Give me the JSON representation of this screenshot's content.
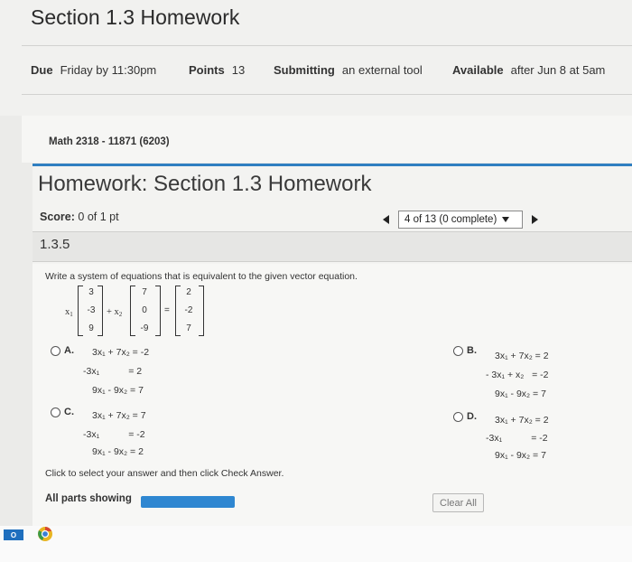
{
  "assignment": {
    "title": "Section 1.3 Homework",
    "details": [
      {
        "label": "Due",
        "value": "Friday by 11:30pm"
      },
      {
        "label": "Points",
        "value": "13"
      },
      {
        "label": "Submitting",
        "value": "an external tool"
      },
      {
        "label": "Available",
        "value": "after Jun 8 at 5am"
      }
    ]
  },
  "course": {
    "name": "Math 2318 - 11871 (6203)"
  },
  "homework": {
    "title": "Homework: Section 1.3 Homework",
    "score_label": "Score:",
    "score_value": "0 of 1 pt",
    "progress": "4 of 13 (0 complete)",
    "question_number": "1.3.5"
  },
  "question": {
    "prompt": "Write a system of equations that is equivalent to the given vector equation.",
    "vector_equation": {
      "x1_label": "x",
      "x1_sub": "1",
      "x2_label": "+ x",
      "x2_sub": "2",
      "v1": [
        "3",
        "-3",
        "9"
      ],
      "v2": [
        "7",
        "0",
        "-9"
      ],
      "equals": "=",
      "rhs": [
        "2",
        "-2",
        "7"
      ]
    },
    "options": [
      {
        "letter": "A.",
        "eqs": [
          "3x₁ + 7x₂ = -2",
          "-3x₁           = 2",
          "9x₁ - 9x₂ = 7"
        ]
      },
      {
        "letter": "B.",
        "eqs": [
          "3x₁ + 7x₂ = 2",
          "- 3x₁ + x₂   = -2",
          "9x₁ - 9x₂ = 7"
        ]
      },
      {
        "letter": "C.",
        "eqs": [
          "3x₁ + 7x₂ = 7",
          "-3x₁           = -2",
          "9x₁ - 9x₂ = 2"
        ]
      },
      {
        "letter": "D.",
        "eqs": [
          "3x₁ + 7x₂ = 2",
          "-3x₁           = -2",
          "9x₁ - 9x₂ = 7"
        ]
      }
    ],
    "hint": "Click to select your answer and then click Check Answer.",
    "parts_label": "All parts showing",
    "clear_all": "Clear All"
  },
  "taskbar": {
    "outlook_badge": "O"
  }
}
